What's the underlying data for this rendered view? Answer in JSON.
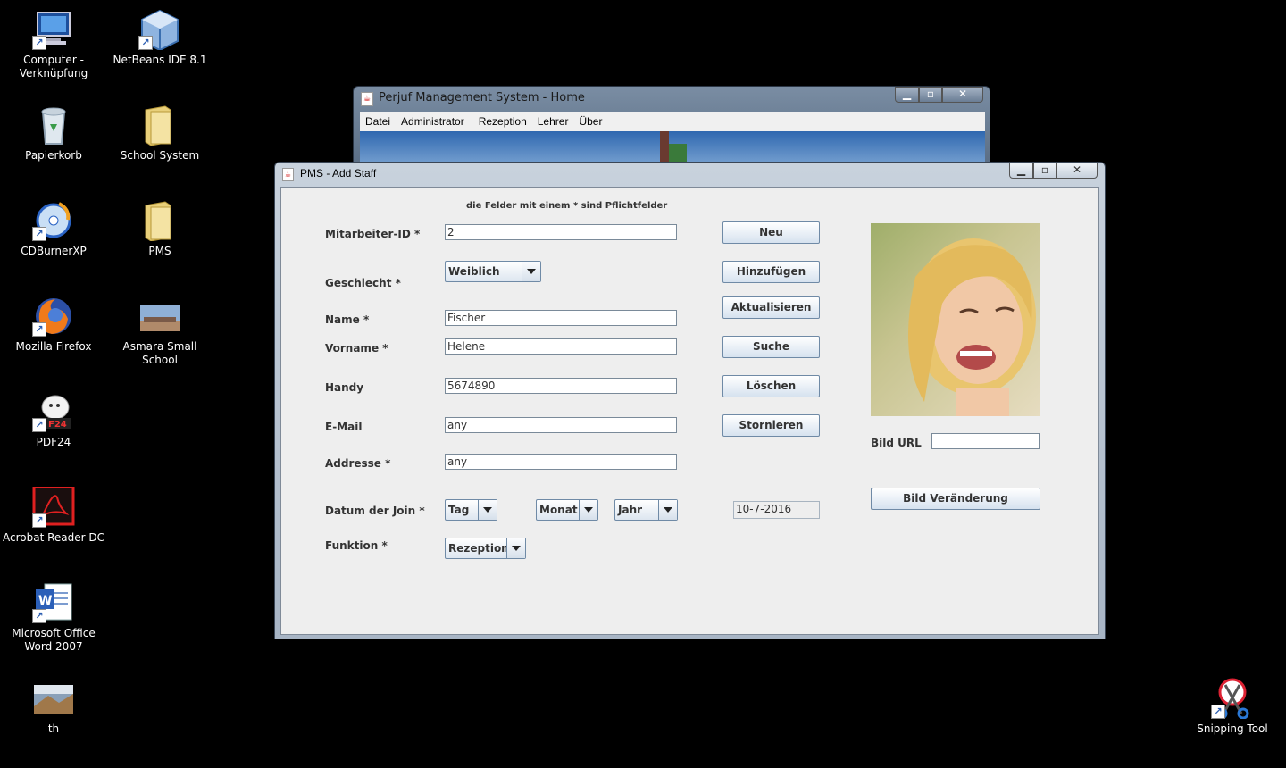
{
  "desktop": {
    "icons": [
      {
        "label": "Computer -\nVerknüpfung",
        "icon": "computer-icon"
      },
      {
        "label": "NetBeans IDE 8.1",
        "icon": "netbeans-icon"
      },
      {
        "label": "Papierkorb",
        "icon": "recycle-bin-icon"
      },
      {
        "label": "School System",
        "icon": "folder-icon"
      },
      {
        "label": "CDBurnerXP",
        "icon": "cdburner-icon"
      },
      {
        "label": "PMS",
        "icon": "folder-icon"
      },
      {
        "label": "Mozilla Firefox",
        "icon": "firefox-icon"
      },
      {
        "label": "Asmara Small School",
        "icon": "photo-icon"
      },
      {
        "label": "PDF24",
        "icon": "pdf24-icon"
      },
      {
        "label": "Acrobat Reader DC",
        "icon": "acrobat-icon"
      },
      {
        "label": "Microsoft Office\nWord 2007",
        "icon": "word-icon"
      },
      {
        "label": "th",
        "icon": "photo-icon"
      },
      {
        "label": "Snipping Tool",
        "icon": "snipping-tool-icon"
      }
    ]
  },
  "back_window": {
    "title": "Perjuf Management System - Home",
    "menu": [
      "Datei",
      "Administrator",
      "Rezeption",
      "Lehrer",
      "Über"
    ]
  },
  "front_window": {
    "title": "PMS - Add Staff",
    "hint": "die Felder mit einem * sind Pflichtfelder",
    "labels": {
      "id": "Mitarbeiter-ID *",
      "gender": "Geschlecht *",
      "name": "Name *",
      "firstname": "Vorname *",
      "mobile": "Handy",
      "email": "E-Mail",
      "address": "Addresse *",
      "join_date": "Datum der Join *",
      "function": "Funktion *",
      "image_url": "Bild URL"
    },
    "values": {
      "id": "2",
      "gender": "Weiblich",
      "name": "Fischer",
      "firstname": "Helene",
      "mobile": "5674890",
      "email": "any",
      "address": "any",
      "day": "Tag",
      "month": "Monat",
      "year": "Jahr",
      "date_display": "10-7-2016",
      "function": "Rezeption",
      "image_url": ""
    },
    "buttons": {
      "new": "Neu",
      "add": "Hinzufügen",
      "update": "Aktualisieren",
      "search": "Suche",
      "delete": "Löschen",
      "cancel": "Stornieren",
      "change_image": "Bild Veränderung"
    }
  }
}
